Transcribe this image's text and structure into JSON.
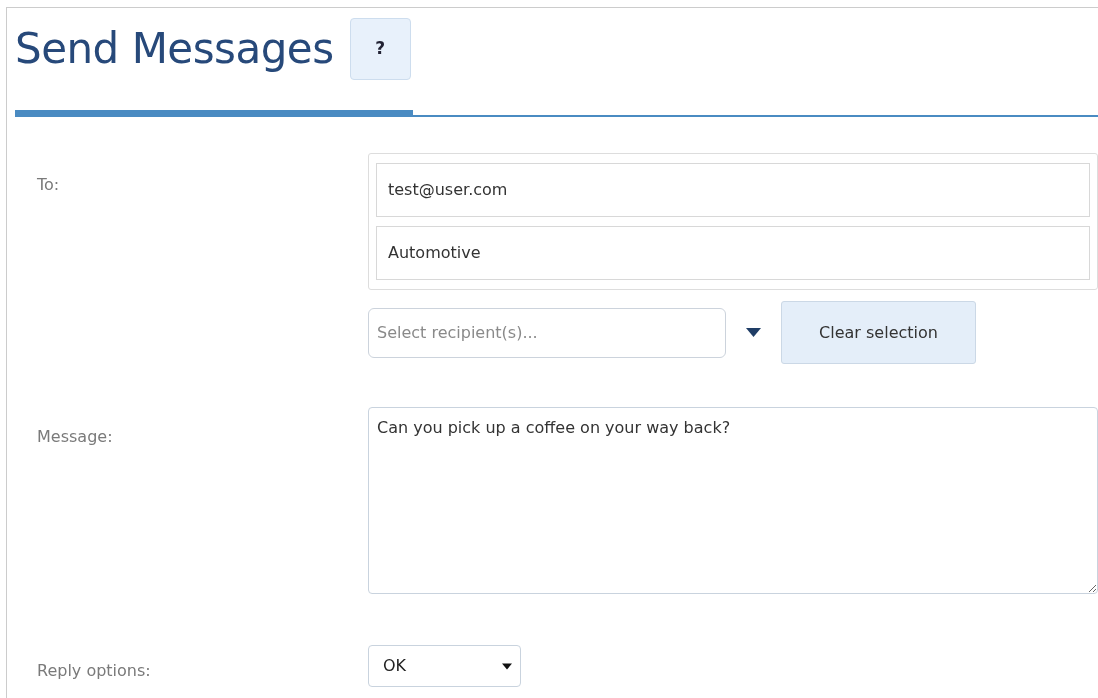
{
  "title": "Send Messages",
  "help_button": {
    "label": "?"
  },
  "tabs": [
    {
      "selected": true
    }
  ],
  "fields": [
    {
      "kind": "recipients",
      "label": "To:",
      "recipients": [
        "test@user.com",
        "Automotive"
      ],
      "picker": {
        "placeholder": "Select recipient(s)..."
      },
      "clear_button": "Clear selection"
    },
    {
      "kind": "textarea",
      "label": "Message:",
      "value": "Can you pick up a coffee on your way back?"
    },
    {
      "kind": "select",
      "label": "Reply options:",
      "value": "OK"
    }
  ]
}
